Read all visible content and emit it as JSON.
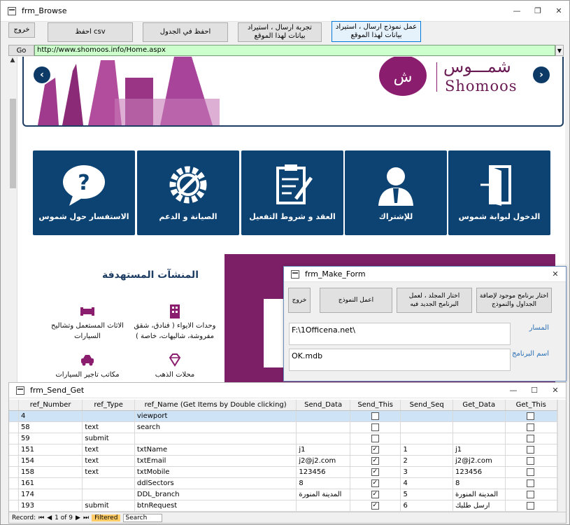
{
  "main_window": {
    "title": "frm_Browse"
  },
  "toolbar": {
    "exit_label": "خروج",
    "save_csv_label": "احفظ csv",
    "save_table_label": "احفظ في الجدول",
    "test_send_label": "تجربة ارسال ، استيراد بيانات لهذا الموقع",
    "make_model_label": "عمل نموذج ارسال ، استيراد بيانات لهذا الموقع"
  },
  "address_bar": {
    "go_label": "Go",
    "url": "http://www.shomoos.info/Home.aspx"
  },
  "site": {
    "brand_arabic": "شمـــوس",
    "brand_english": "Shomoos",
    "tiles": [
      {
        "label": "الاستفسار حول شموس",
        "icon": "question-bubble-icon"
      },
      {
        "label": "الصيانة و الدعم",
        "icon": "gear-wrench-icon"
      },
      {
        "label": "العقد و شروط التفعيل",
        "icon": "clipboard-pen-icon"
      },
      {
        "label": "للإشتراك",
        "icon": "user-suit-icon"
      },
      {
        "label": "الدخول لبوابة شموس",
        "icon": "door-exit-icon"
      }
    ],
    "section_title": "المنشآت المستهدفة",
    "features": [
      {
        "label": "الاثاث المستعمل وتشاليح السيارات",
        "icon": "sofa-icon"
      },
      {
        "label": "وحدات الايواء ( فنادق، شقق مفروشة، شاليهات، خاصة )",
        "icon": "building-icon"
      },
      {
        "label": "مكاتب تاجير السيارات",
        "icon": "car-icon"
      },
      {
        "label": "محلات الذهب",
        "icon": "diamond-icon"
      }
    ]
  },
  "make_form": {
    "title": "frm_Make_Form",
    "btn_pick_existing": "اختار برنامج موجود لإضافة الجداول والنموذج",
    "btn_pick_folder": "اختار المجلد ، لعمل البرنامج الجديد فيه",
    "btn_make_model": "اعمل النموذج",
    "btn_exit": "خروج",
    "path_label": "المسار",
    "path_value": "F:\\1Officena.net\\",
    "program_label": "اسم البرنامج",
    "program_value": "OK.mdb"
  },
  "send_get": {
    "title": "frm_Send_Get",
    "columns": [
      "ref_Number",
      "ref_Type",
      "ref_Name (Get Items by Double clicking)",
      "Send_Data",
      "Send_This",
      "Send_Seq",
      "Get_Data",
      "Get_This"
    ],
    "rows": [
      {
        "ref_Number": "4",
        "ref_Type": "",
        "ref_Name": "viewport",
        "Send_Data": "",
        "Send_This": false,
        "Send_Seq": "",
        "Get_Data": "",
        "Get_This": false
      },
      {
        "ref_Number": "58",
        "ref_Type": "text",
        "ref_Name": "search",
        "Send_Data": "",
        "Send_This": false,
        "Send_Seq": "",
        "Get_Data": "",
        "Get_This": false
      },
      {
        "ref_Number": "59",
        "ref_Type": "submit",
        "ref_Name": "",
        "Send_Data": "",
        "Send_This": false,
        "Send_Seq": "",
        "Get_Data": "",
        "Get_This": false
      },
      {
        "ref_Number": "151",
        "ref_Type": "text",
        "ref_Name": "txtName",
        "Send_Data": "j1",
        "Send_This": true,
        "Send_Seq": "1",
        "Get_Data": "j1",
        "Get_This": false
      },
      {
        "ref_Number": "154",
        "ref_Type": "text",
        "ref_Name": "txtEmail",
        "Send_Data": "j2@j2.com",
        "Send_This": true,
        "Send_Seq": "2",
        "Get_Data": "j2@j2.com",
        "Get_This": false
      },
      {
        "ref_Number": "158",
        "ref_Type": "text",
        "ref_Name": "txtMobile",
        "Send_Data": "123456",
        "Send_This": true,
        "Send_Seq": "3",
        "Get_Data": "123456",
        "Get_This": false
      },
      {
        "ref_Number": "161",
        "ref_Type": "",
        "ref_Name": "ddlSectors",
        "Send_Data": "8",
        "Send_This": true,
        "Send_Seq": "4",
        "Get_Data": "8",
        "Get_This": false
      },
      {
        "ref_Number": "174",
        "ref_Type": "",
        "ref_Name": "DDL_branch",
        "Send_Data": "المدينة المنورة",
        "Send_This": true,
        "Send_Seq": "5",
        "Get_Data": "المدينة المنورة",
        "Get_This": false
      },
      {
        "ref_Number": "193",
        "ref_Type": "submit",
        "ref_Name": "btnRequest",
        "Send_Data": "",
        "Send_This": true,
        "Send_Seq": "6",
        "Get_Data": "ارسل طلبك",
        "Get_This": false
      }
    ],
    "status": {
      "record_label": "Record:",
      "position": "1 of 9",
      "filtered_label": "Filtered",
      "search_label": "Search"
    }
  },
  "colors": {
    "tile_blue": "#0d4372",
    "brand_purple": "#7c1f66",
    "url_green": "#ccffcc"
  }
}
